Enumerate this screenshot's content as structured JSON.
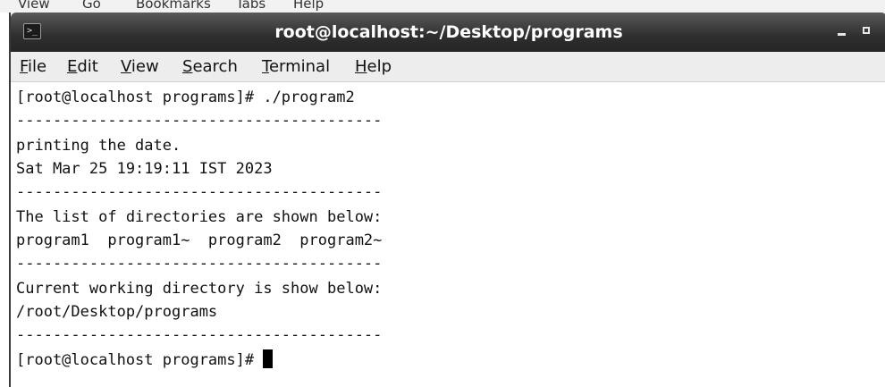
{
  "background_menu": {
    "items": [
      "View",
      "Go",
      "Bookmarks",
      "Tabs",
      "Help"
    ]
  },
  "window": {
    "title": "root@localhost:~/Desktop/programs",
    "app_icon": "terminal-icon"
  },
  "menu": {
    "file": {
      "mnemonic": "F",
      "rest": "ile"
    },
    "edit": {
      "mnemonic": "E",
      "rest": "dit"
    },
    "view": {
      "mnemonic": "V",
      "rest": "iew"
    },
    "search": {
      "mnemonic": "S",
      "rest": "earch"
    },
    "terminal": {
      "mnemonic": "T",
      "rest": "erminal"
    },
    "help": {
      "mnemonic": "H",
      "rest": "elp"
    }
  },
  "terminal": {
    "lines": [
      "[root@localhost programs]# ./program2",
      "----------------------------------------",
      "printing the date.",
      "Sat Mar 25 19:19:11 IST 2023",
      "----------------------------------------",
      "The list of directories are shown below:",
      "program1  program1~  program2  program2~",
      "----------------------------------------",
      "Current working directory is show below:",
      "/root/Desktop/programs",
      "----------------------------------------"
    ],
    "prompt": "[root@localhost programs]# "
  },
  "colors": {
    "titlebar": "#2e2e2e",
    "menubar": "#ededed",
    "terminal_bg": "#ffffff",
    "terminal_fg": "#111111"
  }
}
